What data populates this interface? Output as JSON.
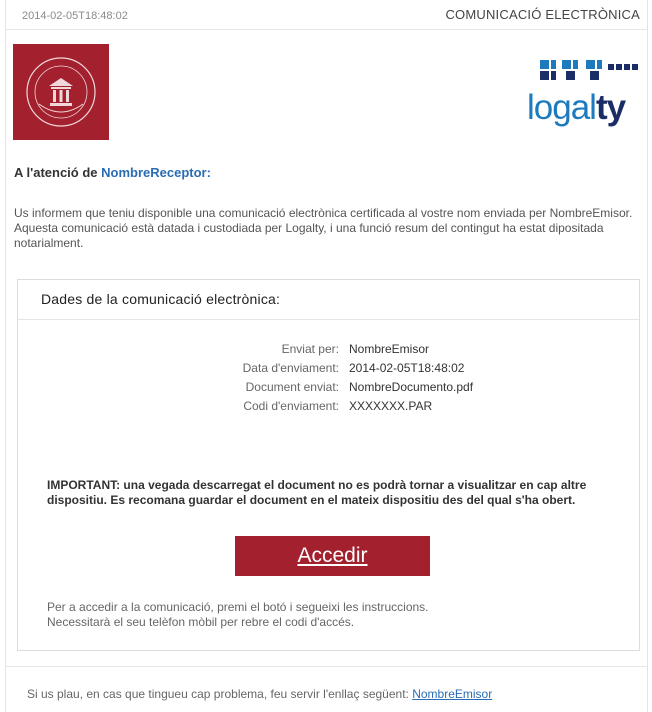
{
  "header": {
    "timestamp": "2014-02-05T18:48:02",
    "title": "COMUNICACIÓ ELECTRÒNICA"
  },
  "logo": {
    "word_light": "logal",
    "word_bold": "ty"
  },
  "greeting": {
    "prefix": "A l'atenció de ",
    "receiver": "NombreReceptor:"
  },
  "intro_text": "Us informem que teniu disponible una comunicació electrònica certificada al vostre nom enviada per NombreEmisor. Aquesta comunicació està datada i custodiada per Logalty, i una funció resum del contingut ha estat dipositada notarialment.",
  "card": {
    "title": "Dades de la comunicació electrònica:",
    "details": [
      {
        "label": "Enviat per:",
        "value": "NombreEmisor"
      },
      {
        "label": "Data d'enviament:",
        "value": "2014-02-05T18:48:02"
      },
      {
        "label": "Document enviat:",
        "value": "NombreDocumento.pdf"
      },
      {
        "label": "Codi d'enviament:",
        "value": "XXXXXXX.PAR"
      }
    ],
    "important": "IMPORTANT: una vegada descarregat el document no es podrà tornar a visualitzar en cap altre dispositiu. Es recomana guardar el document en el mateix dispositiu des del qual s'ha obert.",
    "button_label": "Accedir",
    "instructions_line1": "Per a accedir a la comunicació, premi el botó i segueixi les instruccions.",
    "instructions_line2": "Necessitarà el seu telèfon mòbil per rebre el codi d'accés."
  },
  "footer": {
    "text": "Si us plau, en cas que tingueu cap problema, feu servir l'enllaç següent: ",
    "link": "NombreEmisor"
  },
  "colors": {
    "brand_red": "#a3202e",
    "logo_blue": "#1d7bbd",
    "logo_navy": "#1b2d66",
    "link_blue": "#2a6db5"
  },
  "icons": {
    "seal": "college-seal-icon",
    "logo_mark": "logalty-mark-icon"
  }
}
